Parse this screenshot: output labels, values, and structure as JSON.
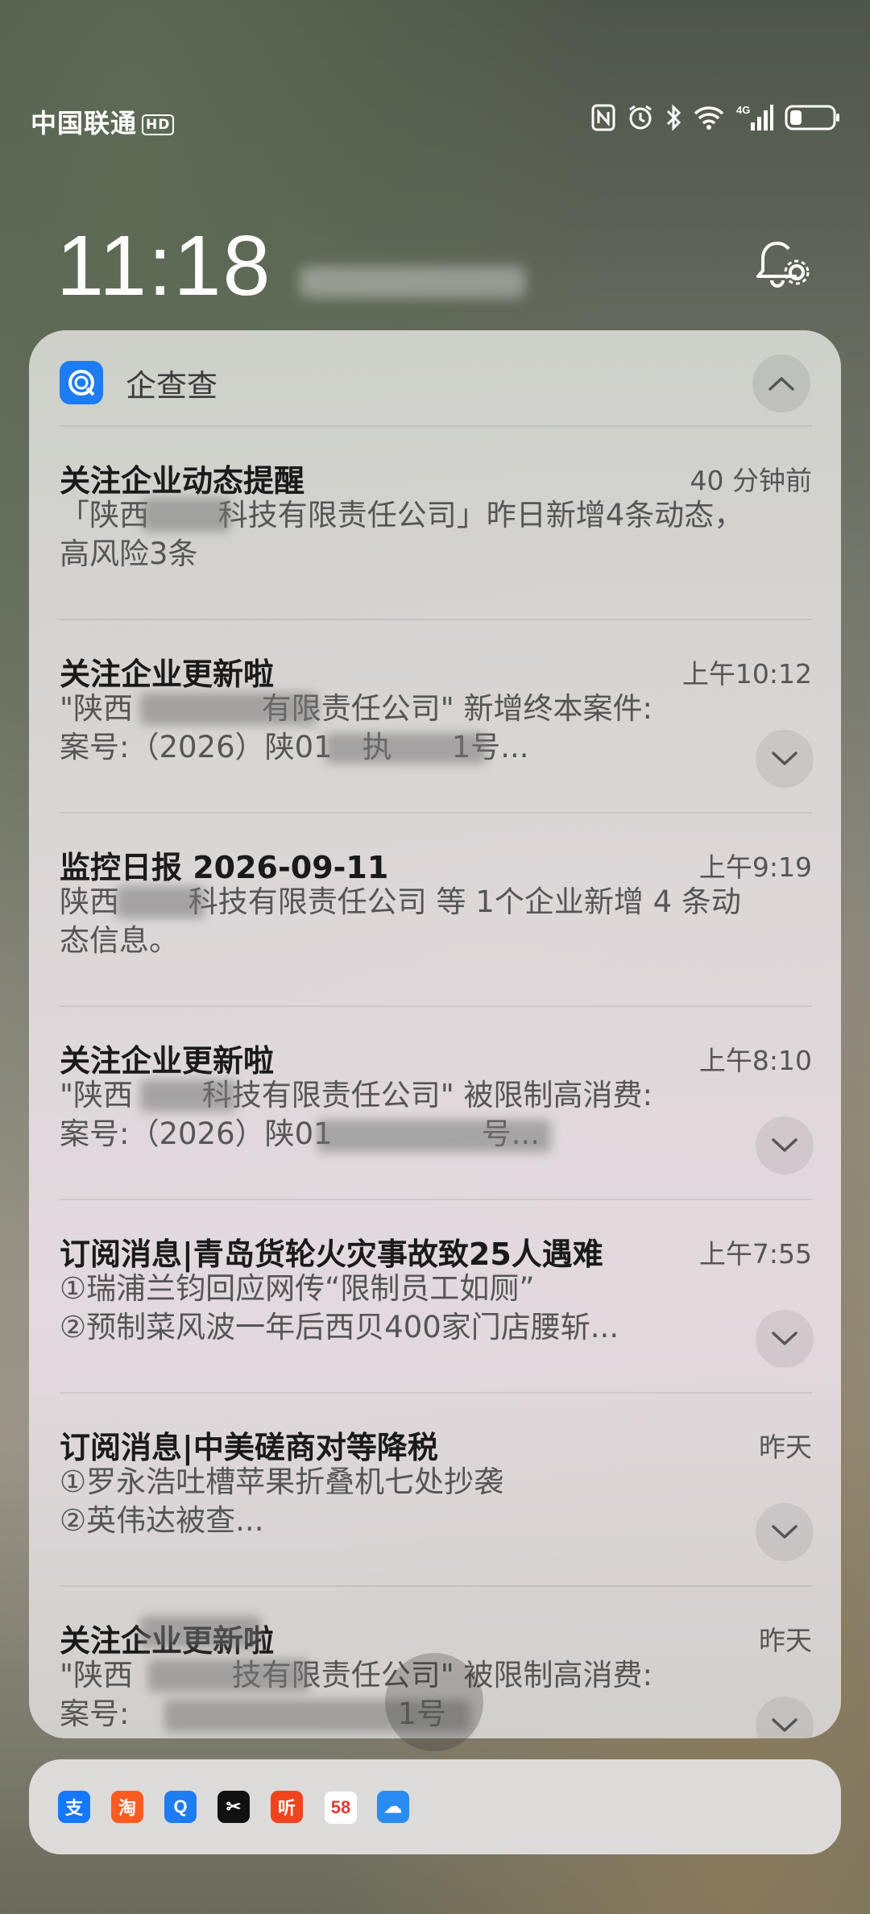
{
  "status_bar": {
    "carrier": "中国联通",
    "hd_badge": "HD",
    "network": "4G",
    "icons": [
      "nfc-icon",
      "alarm-icon",
      "bluetooth-icon",
      "wifi-icon",
      "signal-icon",
      "battery-icon"
    ]
  },
  "lockscreen": {
    "time": "11:18"
  },
  "notification_group": {
    "app_name": "企查查",
    "items": [
      {
        "title": "关注企业动态提醒",
        "time": "40 分钟前",
        "body": "「陕西　　 科技有限责任公司」昨日新增4条动态，\n高风险3条",
        "expandable": false
      },
      {
        "title": "关注企业更新啦",
        "time": "上午10:12",
        "body": "\"陕西　　　 　有限责任公司\" 新增终本案件:\n案号:（2026）陕01　执　　1号...",
        "expandable": true
      },
      {
        "title": "监控日报 2026-09-11",
        "time": "上午9:19",
        "body": "陕西　　 科技有限责任公司 等 1个企业新增 4 条动\n态信息。",
        "expandable": false
      },
      {
        "title": "关注企业更新啦",
        "time": "上午8:10",
        "body": "\"陕西　　 科技有限责任公司\" 被限制高消费:\n案号:（2026）陕01　　　　　号...",
        "expandable": true
      },
      {
        "title": "订阅消息|青岛货轮火灾事故致25人遇难",
        "time": "上午7:55",
        "body": "①瑞浦兰钧回应网传“限制员工如厕”\n②预制菜风波一年后西贝400家门店腰斩...",
        "expandable": true
      },
      {
        "title": "订阅消息|中美磋商对等降税",
        "time": "昨天",
        "body": "①罗永浩吐槽苹果折叠机七处抄袭\n②英伟达被查...",
        "expandable": true
      },
      {
        "title": "关注企业更新啦",
        "time": "昨天",
        "body": "\"陕西　　　 技有限责任公司\" 被限制高消费:\n案号:　　　　　　　　　1号",
        "expandable": true
      }
    ]
  },
  "dock": {
    "apps": [
      {
        "name": "alipay-icon",
        "glyph": "支",
        "color": "#1677ff"
      },
      {
        "name": "taobao-icon",
        "glyph": "淘",
        "color": "#ff5a1f"
      },
      {
        "name": "qichacha-icon",
        "glyph": "Q",
        "color": "#1d7cf2"
      },
      {
        "name": "capcut-icon",
        "glyph": "✂",
        "color": "#111111"
      },
      {
        "name": "ximalaya-icon",
        "glyph": "听",
        "color": "#f2431c"
      },
      {
        "name": "58-icon",
        "glyph": "58",
        "color": "#ffffff"
      },
      {
        "name": "weather-icon",
        "glyph": "☁",
        "color": "#2a8cf0"
      }
    ]
  }
}
